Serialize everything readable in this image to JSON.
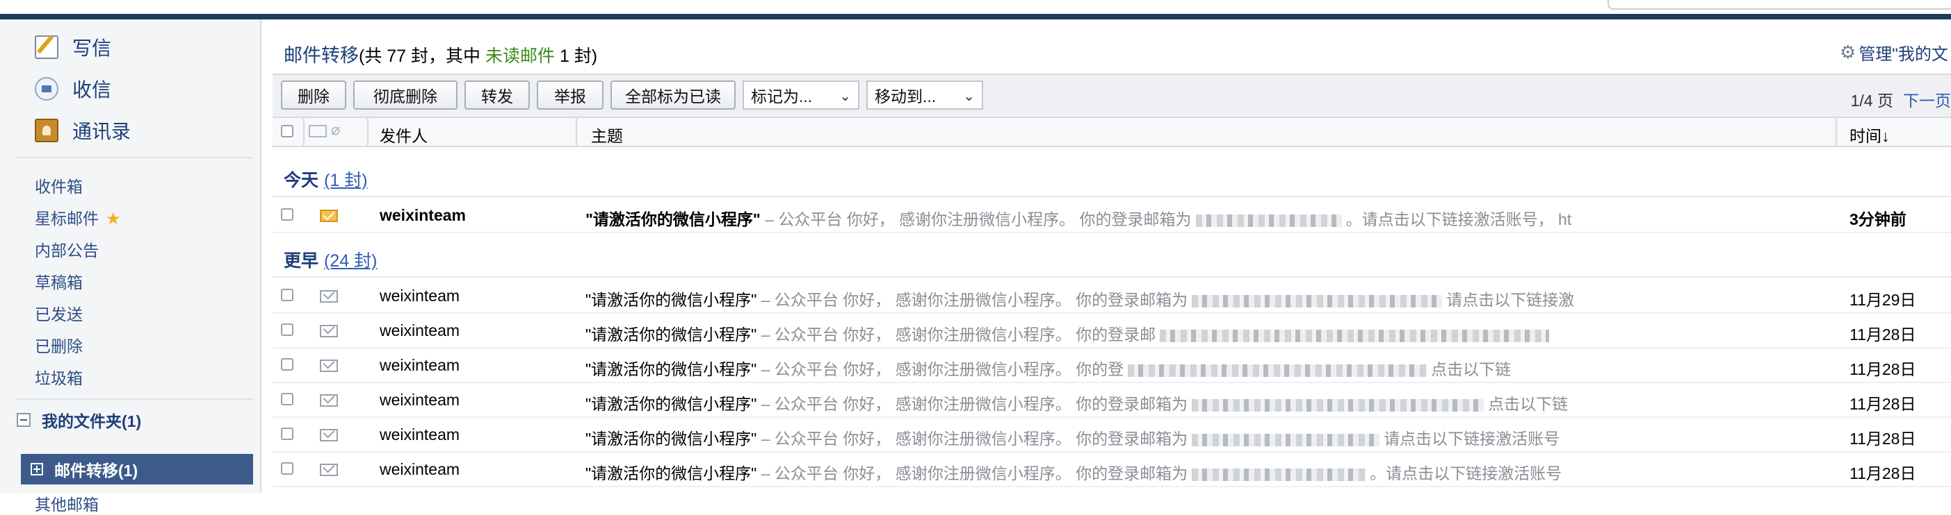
{
  "sidebar": {
    "compose": "写信",
    "receive": "收信",
    "contacts": "通讯录",
    "folders": [
      "收件箱",
      "星标邮件",
      "内部公告",
      "草稿箱",
      "已发送",
      "已删除",
      "垃圾箱"
    ],
    "my_folders": "我的文件夹(1)",
    "selected_folder": "邮件转移(1)",
    "other_mailbox": "其他邮箱"
  },
  "header": {
    "folder_title": "邮件转移",
    "summary_prefix": "(共 77 封，其中 ",
    "unread_link": "未读邮件",
    "summary_suffix": " 1 封)",
    "manage": "管理\"我的文"
  },
  "toolbar": {
    "delete": "删除",
    "delete_permanently": "彻底删除",
    "forward": "转发",
    "report": "举报",
    "mark_all_read": "全部标为已读",
    "mark_as": "标记为...",
    "move_to": "移动到...",
    "page_info": "1/4 页",
    "next_page": "下一页"
  },
  "columns": {
    "sender": "发件人",
    "subject": "主题",
    "time": "时间↓"
  },
  "groups": {
    "today": {
      "label": "今天",
      "count": "(1 封)"
    },
    "earlier": {
      "label": "更早",
      "count": "(24 封)"
    }
  },
  "emails": [
    {
      "sender": "weixinteam",
      "subject": "\"请激活你的微信小程序\"",
      "preview_a": " – 公众平台 你好，  感谢你注册微信小程序。 你的登录邮箱为",
      "preview_b": "。请点击以下链接激活账号，  ht",
      "time": "3分钟前",
      "unread": true
    },
    {
      "sender": "weixinteam",
      "subject": "\"请激活你的微信小程序\"",
      "preview_a": " – 公众平台 你好，  感谢你注册微信小程序。 你的登录邮箱为",
      "preview_b": "请点击以下链接激",
      "time": "11月29日",
      "unread": false
    },
    {
      "sender": "weixinteam",
      "subject": "\"请激活你的微信小程序\"",
      "preview_a": " – 公众平台 你好，  感谢你注册微信小程序。 你的登录邮",
      "preview_b": "",
      "time": "11月28日",
      "unread": false
    },
    {
      "sender": "weixinteam",
      "subject": "\"请激活你的微信小程序\"",
      "preview_a": " – 公众平台 你好，  感谢你注册微信小程序。 你的登",
      "preview_b": "点击以下链",
      "time": "11月28日",
      "unread": false
    },
    {
      "sender": "weixinteam",
      "subject": "\"请激活你的微信小程序\"",
      "preview_a": " – 公众平台 你好，  感谢你注册微信小程序。 你的登录邮箱为",
      "preview_b": "点击以下链",
      "time": "11月28日",
      "unread": false
    },
    {
      "sender": "weixinteam",
      "subject": "\"请激活你的微信小程序\"",
      "preview_a": " – 公众平台 你好，  感谢你注册微信小程序。 你的登录邮箱为",
      "preview_b": "请点击以下链接激活账号",
      "time": "11月28日",
      "unread": false
    },
    {
      "sender": "weixinteam",
      "subject": "\"请激活你的微信小程序\"",
      "preview_a": " – 公众平台 你好，  感谢你注册微信小程序。 你的登录邮箱为",
      "preview_b": "。请点击以下链接激活账号",
      "time": "11月28日",
      "unread": false
    }
  ]
}
